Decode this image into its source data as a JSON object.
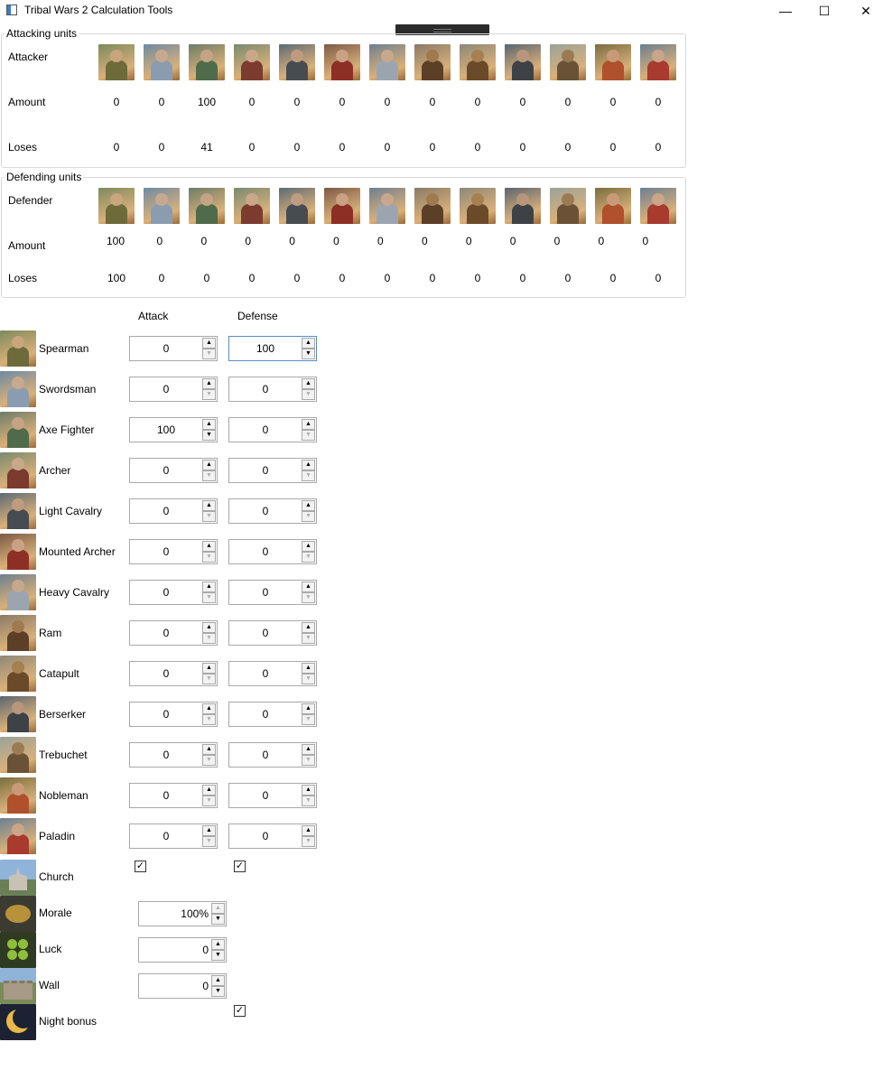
{
  "window": {
    "title": "Tribal Wars 2 Calculation Tools"
  },
  "units": [
    "Spearman",
    "Swordsman",
    "Axe Fighter",
    "Archer",
    "Light Cavalry",
    "Mounted Archer",
    "Heavy Cavalry",
    "Ram",
    "Catapult",
    "Berserker",
    "Trebuchet",
    "Nobleman",
    "Paladin"
  ],
  "unit_icons": [
    "spearman-icon",
    "swordsman-icon",
    "axe-fighter-icon",
    "archer-icon",
    "light-cavalry-icon",
    "mounted-archer-icon",
    "heavy-cavalry-icon",
    "ram-icon",
    "catapult-icon",
    "berserker-icon",
    "trebuchet-icon",
    "nobleman-icon",
    "paladin-icon"
  ],
  "attacking": {
    "legend": "Attacking units",
    "header_label": "Attacker",
    "amount_label": "Amount",
    "loses_label": "Loses",
    "amount": [
      "0",
      "0",
      "100",
      "0",
      "0",
      "0",
      "0",
      "0",
      "0",
      "0",
      "0",
      "0",
      "0"
    ],
    "loses": [
      "0",
      "0",
      "41",
      "0",
      "0",
      "0",
      "0",
      "0",
      "0",
      "0",
      "0",
      "0",
      "0"
    ]
  },
  "defending": {
    "legend": "Defending units",
    "header_label": "Defender",
    "amount_label": "Amount",
    "loses_label": "Loses",
    "amount": [
      "100",
      "0",
      "0",
      "0",
      "0",
      "0",
      "0",
      "0",
      "0",
      "0",
      "0",
      "0",
      "0"
    ],
    "loses": [
      "100",
      "0",
      "0",
      "0",
      "0",
      "0",
      "0",
      "0",
      "0",
      "0",
      "0",
      "0",
      "0"
    ]
  },
  "inputs": {
    "attack_header": "Attack",
    "defense_header": "Defense",
    "attack": [
      "0",
      "0",
      "100",
      "0",
      "0",
      "0",
      "0",
      "0",
      "0",
      "0",
      "0",
      "0",
      "0"
    ],
    "defense": [
      "100",
      "0",
      "0",
      "0",
      "0",
      "0",
      "0",
      "0",
      "0",
      "0",
      "0",
      "0",
      "0"
    ]
  },
  "modifiers": {
    "church_label": "Church",
    "church_attack": true,
    "church_defense": true,
    "morale_label": "Morale",
    "morale_value": "100%",
    "luck_label": "Luck",
    "luck_value": "0",
    "wall_label": "Wall",
    "wall_value": "0",
    "night_label": "Night bonus",
    "night_defense": true
  },
  "colors": {
    "group_border": "#d9d9d9",
    "focus_border": "#5b8cc7",
    "titlebar_handle": "#2b2b2b"
  }
}
